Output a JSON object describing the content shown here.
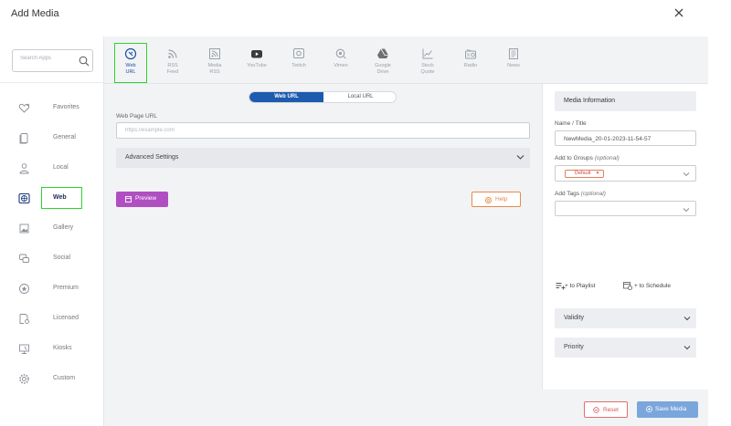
{
  "modal": {
    "title": "Add Media"
  },
  "search": {
    "placeholder": "Search Apps"
  },
  "sidebar": {
    "items": [
      {
        "label": "Favorites",
        "icon": "heart-icon"
      },
      {
        "label": "General",
        "icon": "document-icon"
      },
      {
        "label": "Local",
        "icon": "person-icon"
      },
      {
        "label": "Web",
        "icon": "globe-icon",
        "active": true
      },
      {
        "label": "Gallery",
        "icon": "gallery-icon"
      },
      {
        "label": "Social",
        "icon": "chat-icon"
      },
      {
        "label": "Premium",
        "icon": "star-icon"
      },
      {
        "label": "Licensed",
        "icon": "license-icon"
      },
      {
        "label": "Kiosks",
        "icon": "kiosk-icon"
      },
      {
        "label": "Custom",
        "icon": "gear-icon"
      }
    ]
  },
  "sources": [
    {
      "label_1": "Web",
      "label_2": "URL",
      "icon": "web-url-icon",
      "active": true
    },
    {
      "label_1": "RSS",
      "label_2": "Feed",
      "icon": "rss-icon"
    },
    {
      "label_1": "Media",
      "label_2": "RSS",
      "icon": "media-rss-icon"
    },
    {
      "label_1": "YouTube",
      "label_2": "",
      "icon": "youtube-icon"
    },
    {
      "label_1": "Twitch",
      "label_2": "",
      "icon": "twitch-icon"
    },
    {
      "label_1": "Vimeo",
      "label_2": "",
      "icon": "vimeo-icon"
    },
    {
      "label_1": "Google",
      "label_2": "Drive",
      "icon": "google-drive-icon"
    },
    {
      "label_1": "Stock",
      "label_2": "Quote",
      "icon": "stock-quote-icon"
    },
    {
      "label_1": "Radio",
      "label_2": "",
      "icon": "radio-icon"
    },
    {
      "label_1": "News",
      "label_2": "",
      "icon": "news-icon"
    }
  ],
  "toggle": {
    "web_url": "Web URL",
    "local_url": "Local URL"
  },
  "form": {
    "url_label": "Web Page URL",
    "url_placeholder": "https://example.com",
    "advanced_settings": "Advanced Settings",
    "preview": "Preview",
    "help": "Help"
  },
  "info": {
    "header": "Media Information",
    "name_label": "Name / Title",
    "name_value": "NewMedia_20-01-2023-11-54-57",
    "groups_label": "Add to Groups",
    "optional": "(optional)",
    "group_tag": "Default",
    "tags_label": "Add Tags",
    "to_playlist": "+ to Playlist",
    "to_schedule": "+ to Schedule",
    "validity": "Validity",
    "priority": "Priority",
    "reset": "Reset",
    "save": "Save Media"
  },
  "colors": {
    "primary": "#1d5bae",
    "preview": "#b04fc2",
    "help": "#e9884a",
    "save": "#7aa6dc",
    "highlight": "#2fd22f"
  }
}
